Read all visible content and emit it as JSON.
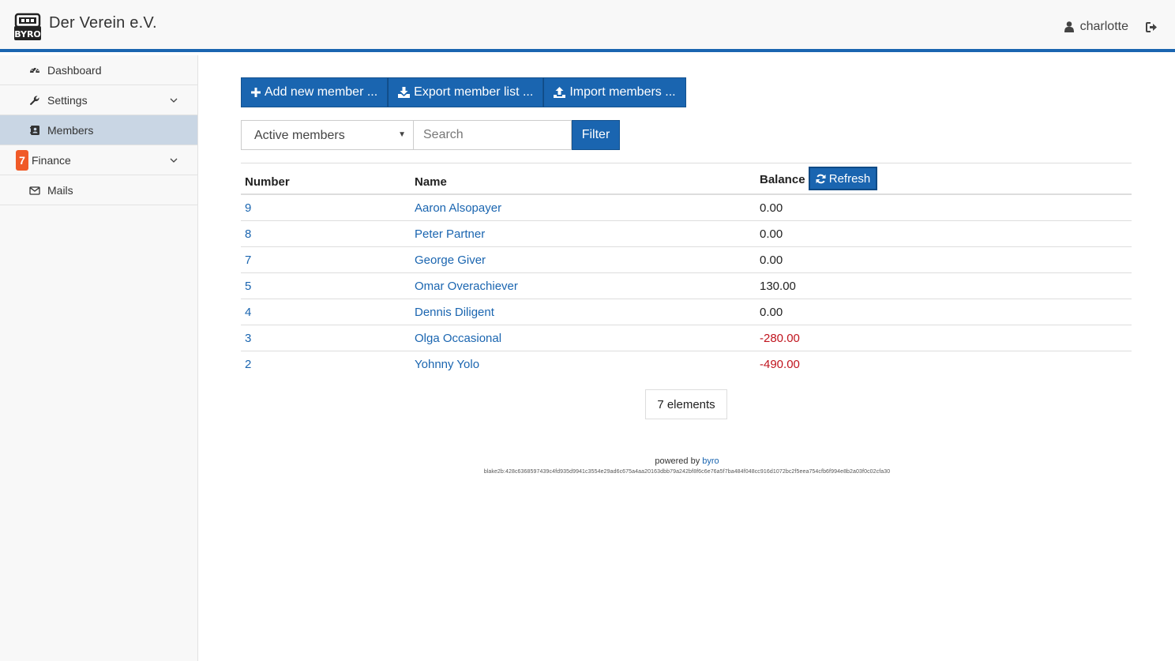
{
  "header": {
    "brand": "Der Verein e.V.",
    "username": "charlotte",
    "accent_color": "#1a65b0"
  },
  "sidebar": {
    "items": [
      {
        "label": "Dashboard",
        "icon": "dashboard-icon"
      },
      {
        "label": "Settings",
        "icon": "wrench-icon",
        "expandable": true
      },
      {
        "label": "Members",
        "icon": "address-book-icon",
        "active": true
      },
      {
        "label": "Finance",
        "badge": "7",
        "expandable": true
      },
      {
        "label": "Mails",
        "icon": "envelope-icon"
      }
    ]
  },
  "toolbar": {
    "add_label": "Add new member ...",
    "export_label": "Export member list ...",
    "import_label": "Import members ..."
  },
  "filter": {
    "selected": "Active members",
    "search_placeholder": "Search",
    "filter_label": "Filter"
  },
  "table": {
    "headers": {
      "number": "Number",
      "name": "Name",
      "balance": "Balance"
    },
    "refresh_label": "Refresh",
    "rows": [
      {
        "number": "9",
        "name": "Aaron Alsopayer",
        "balance": "0.00"
      },
      {
        "number": "8",
        "name": "Peter Partner",
        "balance": "0.00"
      },
      {
        "number": "7",
        "name": "George Giver",
        "balance": "0.00"
      },
      {
        "number": "5",
        "name": "Omar Overachiever",
        "balance": "130.00"
      },
      {
        "number": "4",
        "name": "Dennis Diligent",
        "balance": "0.00"
      },
      {
        "number": "3",
        "name": "Olga Occasional",
        "balance": "-280.00"
      },
      {
        "number": "2",
        "name": "Yohnny Yolo",
        "balance": "-490.00"
      }
    ],
    "count_label": "7 elements"
  },
  "footer": {
    "powered_by": "powered by",
    "link": "byro",
    "hash": "blake2b:428c6368597439c4fd935d9941c3554e29ad6c675a4aa20163dbb79a242bf8f6c6e76a5f7ba484f048cc916d1072bc2f5eea754cfb6f994e8b2a03f0c02cfa30"
  }
}
